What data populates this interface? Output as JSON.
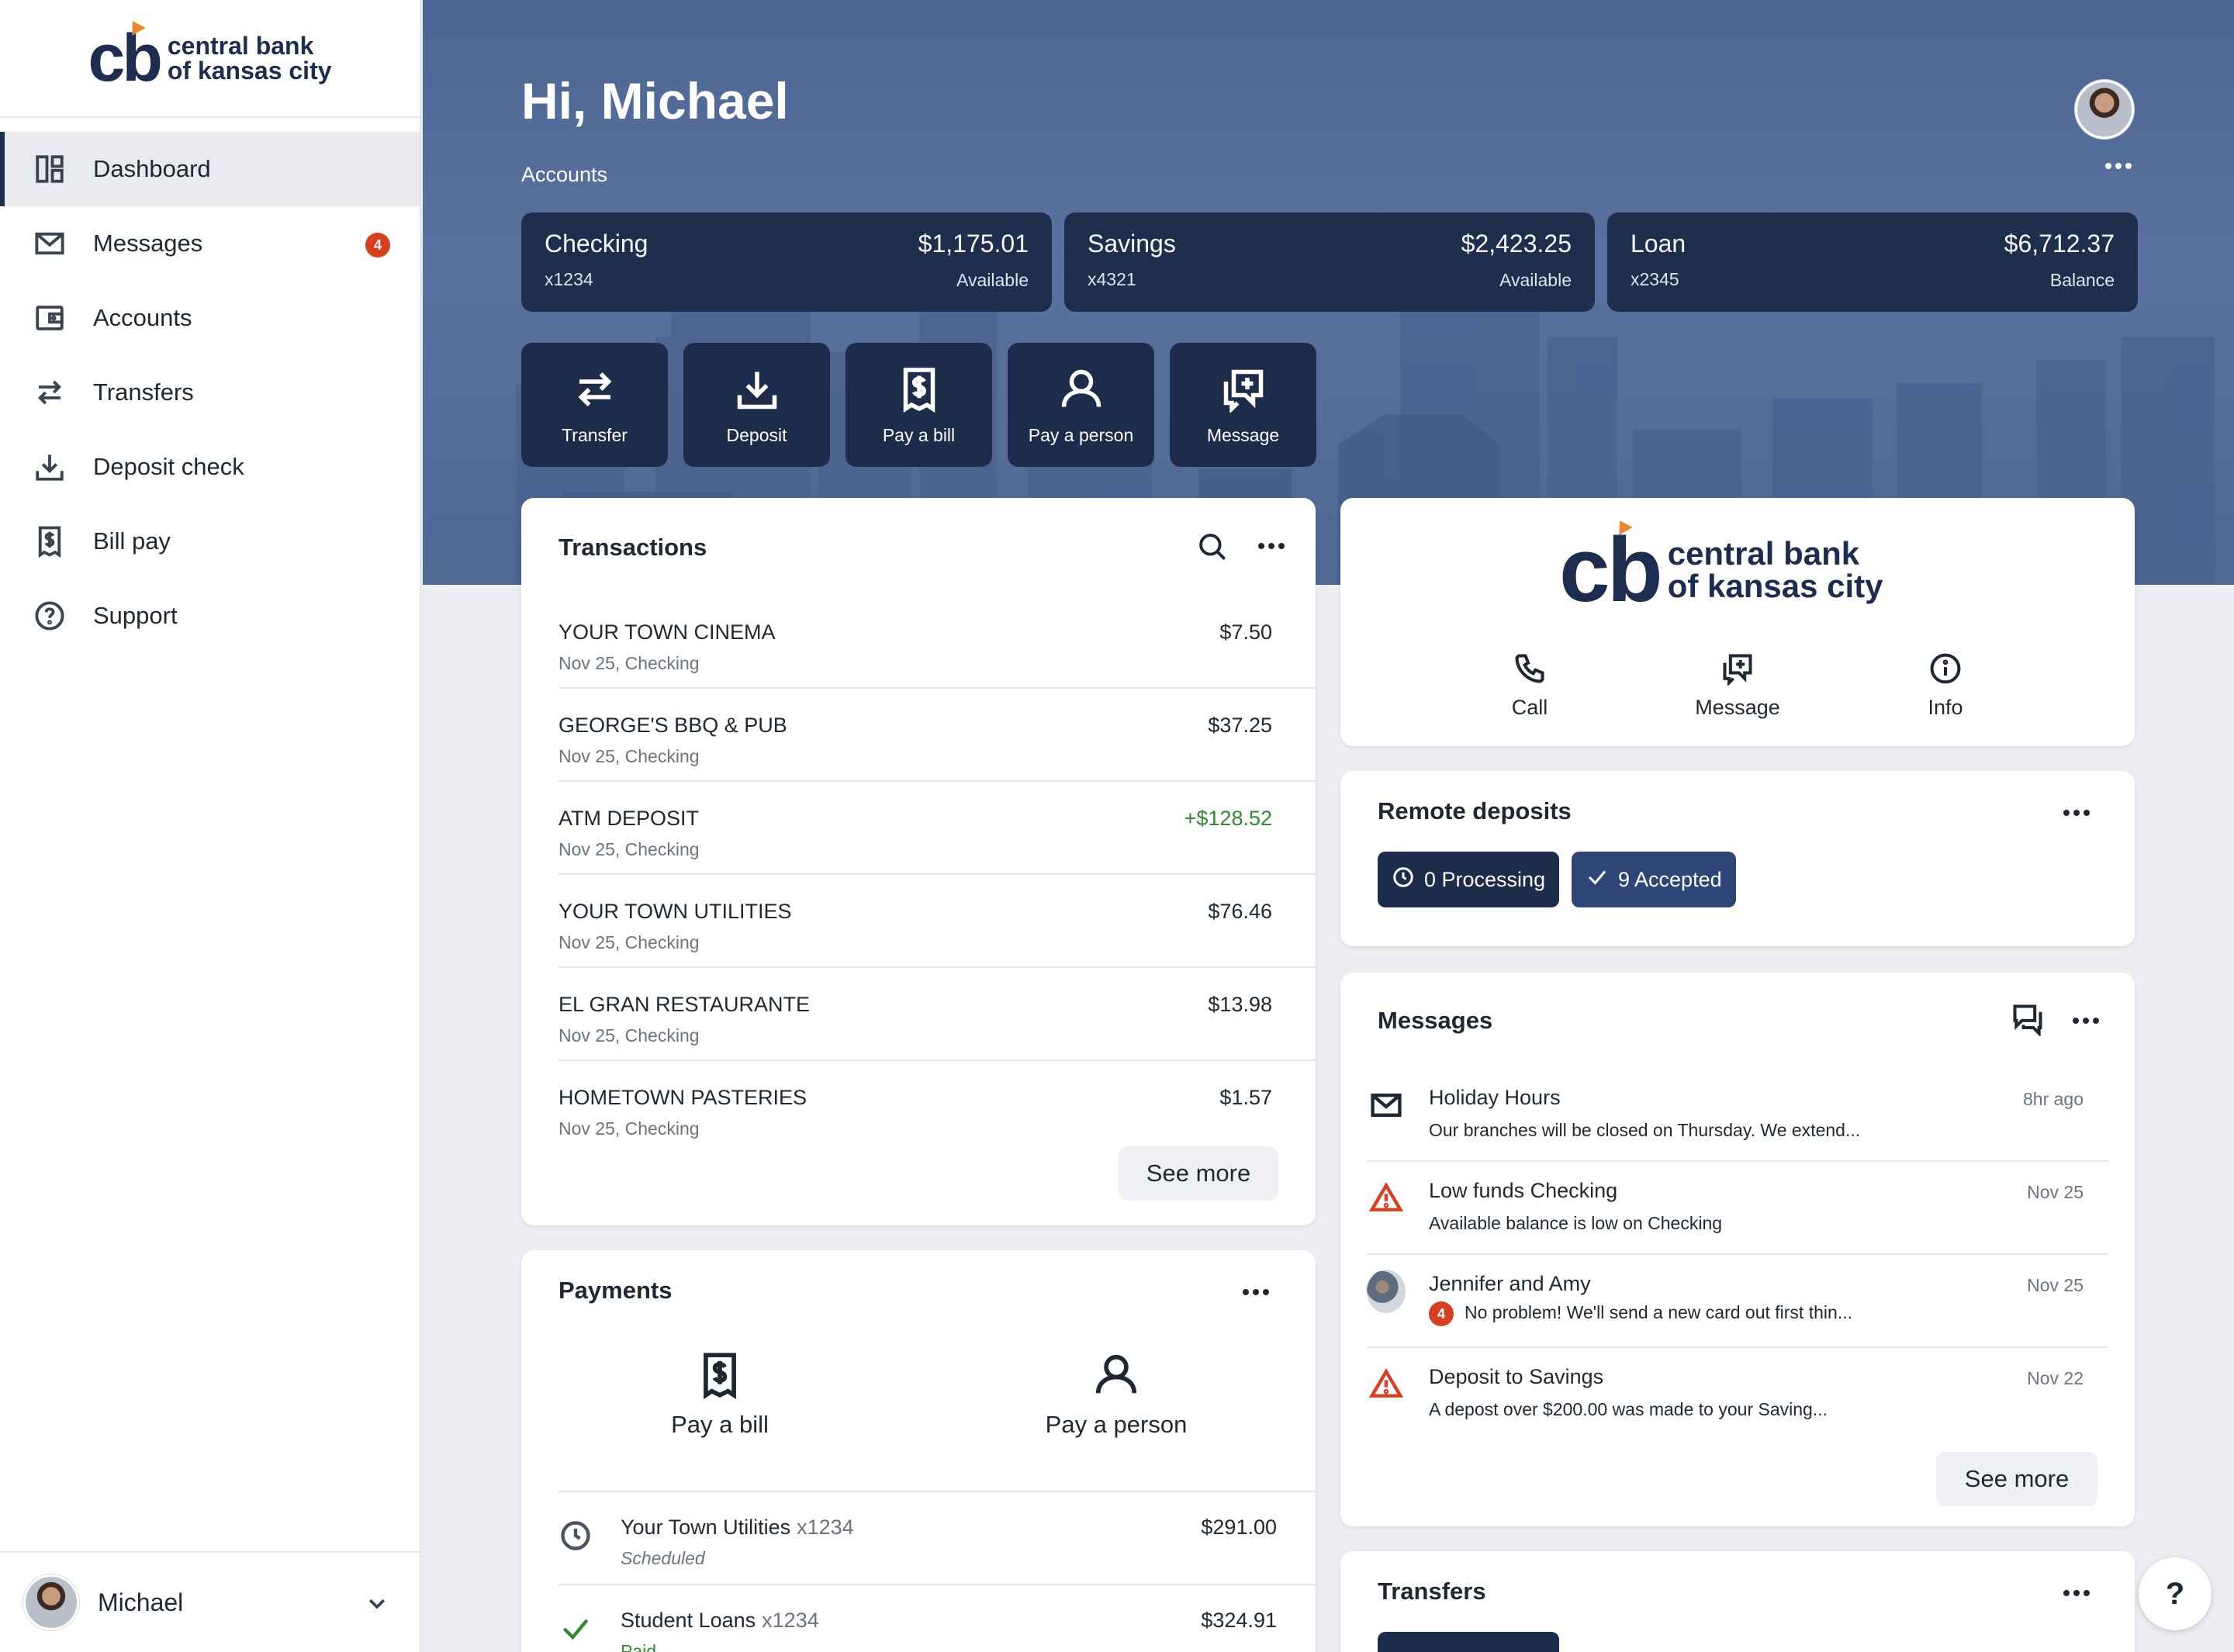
{
  "brand": {
    "line1": "central bank",
    "line2": "of kansas city",
    "mark": "cb",
    "accent_color": "#e98a2f",
    "navy": "#1d2d4f"
  },
  "sidebar": {
    "items": [
      {
        "label": "Dashboard",
        "icon": "dashboard-icon"
      },
      {
        "label": "Messages",
        "icon": "envelope-icon",
        "badge": "4"
      },
      {
        "label": "Accounts",
        "icon": "wallet-icon"
      },
      {
        "label": "Transfers",
        "icon": "transfer-arrows-icon"
      },
      {
        "label": "Deposit check",
        "icon": "download-tray-icon"
      },
      {
        "label": "Bill pay",
        "icon": "receipt-dollar-icon"
      },
      {
        "label": "Support",
        "icon": "question-circle-icon"
      }
    ],
    "user_name": "Michael"
  },
  "hero": {
    "greeting": "Hi, Michael",
    "accounts_label": "Accounts",
    "accounts": [
      {
        "name": "Checking",
        "number": "x1234",
        "balance": "$1,175.01",
        "balance_type": "Available"
      },
      {
        "name": "Savings",
        "number": "x4321",
        "balance": "$2,423.25",
        "balance_type": "Available"
      },
      {
        "name": "Loan",
        "number": "x2345",
        "balance": "$6,712.37",
        "balance_type": "Balance"
      }
    ],
    "actions": [
      {
        "label": "Transfer",
        "icon": "transfer-arrows-icon"
      },
      {
        "label": "Deposit",
        "icon": "download-tray-icon"
      },
      {
        "label": "Pay a bill",
        "icon": "receipt-dollar-icon"
      },
      {
        "label": "Pay a person",
        "icon": "person-icon"
      },
      {
        "label": "Message",
        "icon": "message-plus-icon"
      }
    ]
  },
  "transactions": {
    "title": "Transactions",
    "items": [
      {
        "name": "YOUR TOWN CINEMA",
        "meta": "Nov 25, Checking",
        "amount": "$7.50",
        "credit": false
      },
      {
        "name": "GEORGE'S BBQ & PUB",
        "meta": "Nov 25, Checking",
        "amount": "$37.25",
        "credit": false
      },
      {
        "name": "ATM DEPOSIT",
        "meta": "Nov 25, Checking",
        "amount": "+$128.52",
        "credit": true
      },
      {
        "name": "YOUR TOWN UTILITIES",
        "meta": "Nov 25, Checking",
        "amount": "$76.46",
        "credit": false
      },
      {
        "name": "EL GRAN RESTAURANTE",
        "meta": "Nov 25, Checking",
        "amount": "$13.98",
        "credit": false
      },
      {
        "name": "HOMETOWN PASTERIES",
        "meta": "Nov 25, Checking",
        "amount": "$1.57",
        "credit": false
      }
    ],
    "see_more": "See more"
  },
  "payments": {
    "title": "Payments",
    "options": [
      {
        "label": "Pay a bill",
        "icon": "receipt-dollar-icon"
      },
      {
        "label": "Pay a person",
        "icon": "person-icon"
      }
    ],
    "items": [
      {
        "name": "Your Town Utilities",
        "account": "x1234",
        "status": "Scheduled",
        "amount": "$291.00",
        "icon": "clock-icon"
      },
      {
        "name": "Student Loans",
        "account": "x1234",
        "status": "Paid",
        "amount": "$324.91",
        "icon": "check-icon"
      }
    ]
  },
  "bank_card": {
    "actions": [
      {
        "label": "Call",
        "icon": "phone-icon"
      },
      {
        "label": "Message",
        "icon": "message-plus-icon"
      },
      {
        "label": "Info",
        "icon": "info-icon"
      }
    ]
  },
  "remote_deposits": {
    "title": "Remote deposits",
    "processing": "0 Processing",
    "accepted": "9 Accepted",
    "processing_color": "#1e2c4b",
    "accepted_color": "#2d4677"
  },
  "messages": {
    "title": "Messages",
    "items": [
      {
        "title": "Holiday Hours",
        "body": "Our branches will be closed on Thursday. We extend...",
        "date": "8hr ago",
        "icon": "envelope-icon"
      },
      {
        "title": "Low funds Checking",
        "body": "Available balance is low on Checking",
        "date": "Nov 25",
        "icon": "warning-icon"
      },
      {
        "title": "Jennifer and Amy",
        "body": "No problem! We'll send a new card out first thin...",
        "date": "Nov 25",
        "icon": "group-avatar",
        "badge": "4"
      },
      {
        "title": "Deposit to Savings",
        "body": "A depost over $200.00 was made to your Saving...",
        "date": "Nov 22",
        "icon": "warning-icon"
      }
    ],
    "see_more": "See more"
  },
  "transfers": {
    "title": "Transfers"
  },
  "help": "?",
  "colors": {
    "alert": "#d6401e",
    "credit": "#2f8a2c",
    "card_navy": "#1e2c4b",
    "hero_blue": "#5a72a0"
  }
}
